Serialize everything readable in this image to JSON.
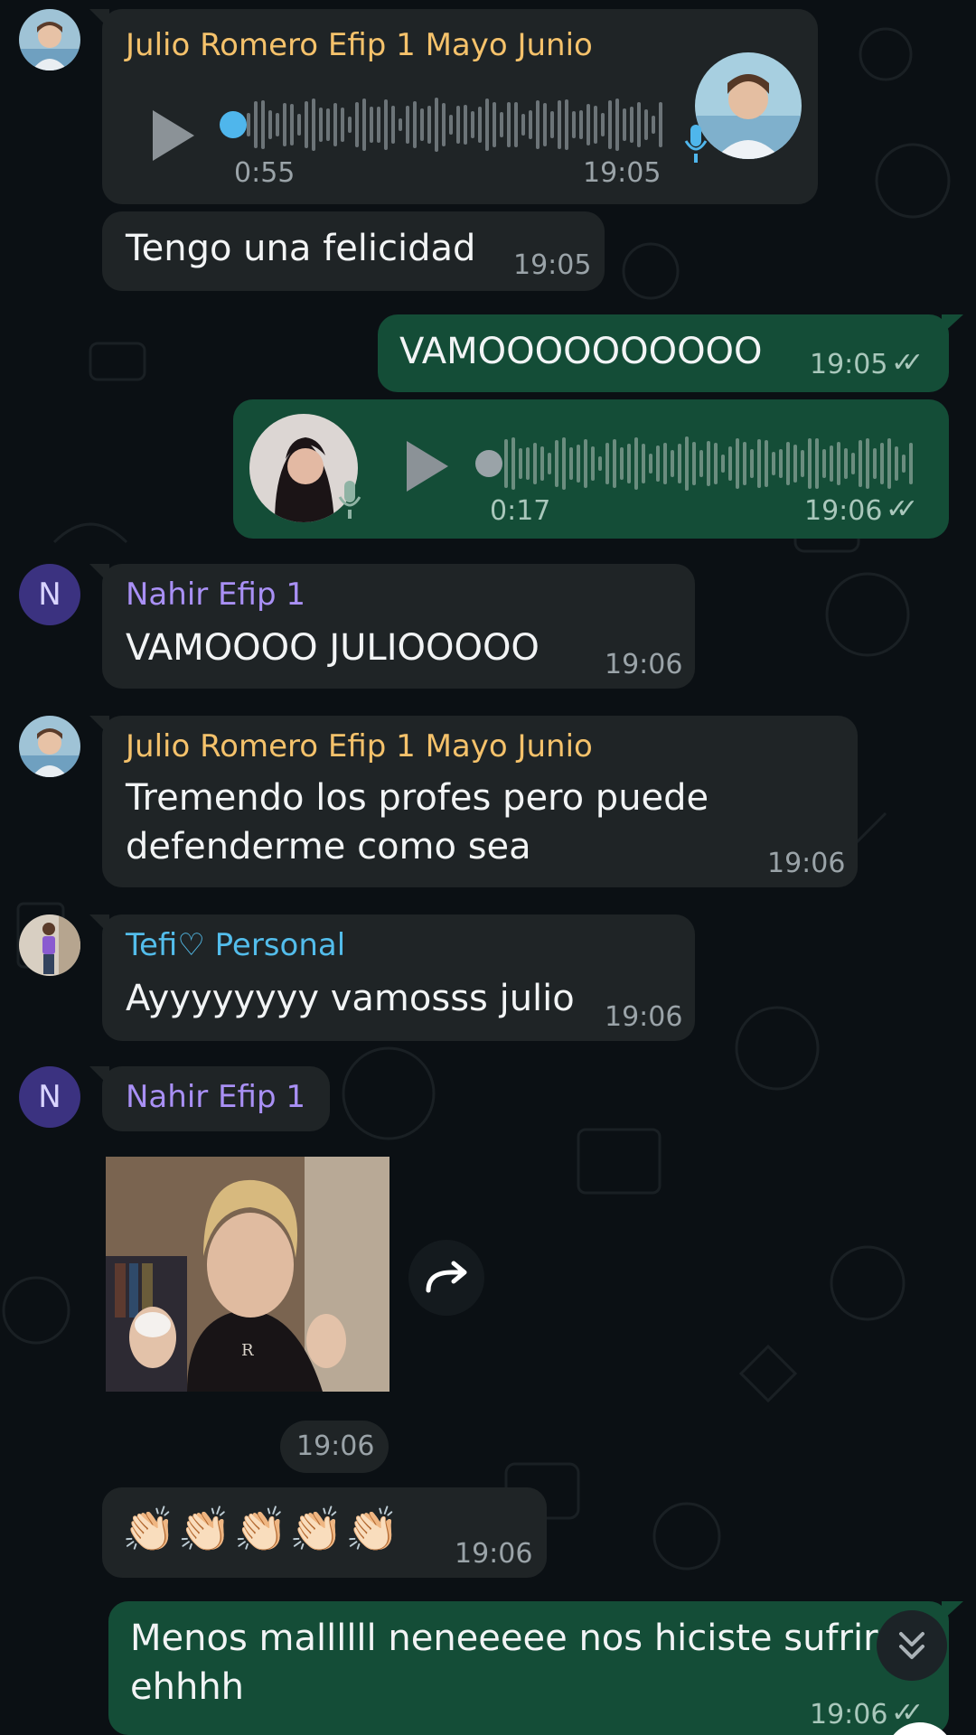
{
  "colors": {
    "background": "#0b1014",
    "incoming_bubble": "#1f2426",
    "outgoing_bubble": "#144d37",
    "name_julio": "#f5c26b",
    "name_nahir": "#a990f5",
    "name_tefi": "#53bdeb",
    "voice_dot_incoming": "#4fb6ec",
    "timestamp": "#9aa3a8"
  },
  "messages": {
    "m1": {
      "sender": "Julio Romero Efip 1 Mayo Junio",
      "type": "voice",
      "duration": "0:55",
      "time": "19:05",
      "avatar_icon": "julio-avatar"
    },
    "m2": {
      "text": "Tengo una felicidad",
      "time": "19:05"
    },
    "m3": {
      "text": "VAMOOOOOOOOOO",
      "time": "19:05",
      "status_icon": "double-check-icon"
    },
    "m4": {
      "type": "voice",
      "duration": "0:17",
      "time": "19:06",
      "status_icon": "double-check-icon",
      "avatar_icon": "own-avatar"
    },
    "m5": {
      "sender": "Nahir Efip 1",
      "avatar_letter": "N",
      "text": "VAMOOOO JULIOOOOO",
      "time": "19:06"
    },
    "m6": {
      "sender": "Julio Romero Efip 1 Mayo Junio",
      "text_line1": "Tremendo los profes pero puede",
      "text_line2": "defenderme como sea",
      "time": "19:06"
    },
    "m7": {
      "sender": "Tefi♡ Personal",
      "text": "Ayyyyyyyy vamosss julio",
      "time": "19:06"
    },
    "m8": {
      "sender": "Nahir Efip 1",
      "avatar_letter": "N",
      "type": "gif",
      "time": "19:06"
    },
    "m9": {
      "text": "👏🏻👏🏻👏🏻👏🏻👏🏻",
      "time": "19:06"
    },
    "m10": {
      "text_line1": "Menos mallllll neneeeee nos hiciste sufrir",
      "text_line2": "ehhhh",
      "time": "19:06",
      "status_icon": "double-check-icon"
    }
  },
  "ticks": "✓✓",
  "buttons": {
    "forward_icon": "forward-icon",
    "scroll_down_icon": "double-chevron-down-icon"
  }
}
